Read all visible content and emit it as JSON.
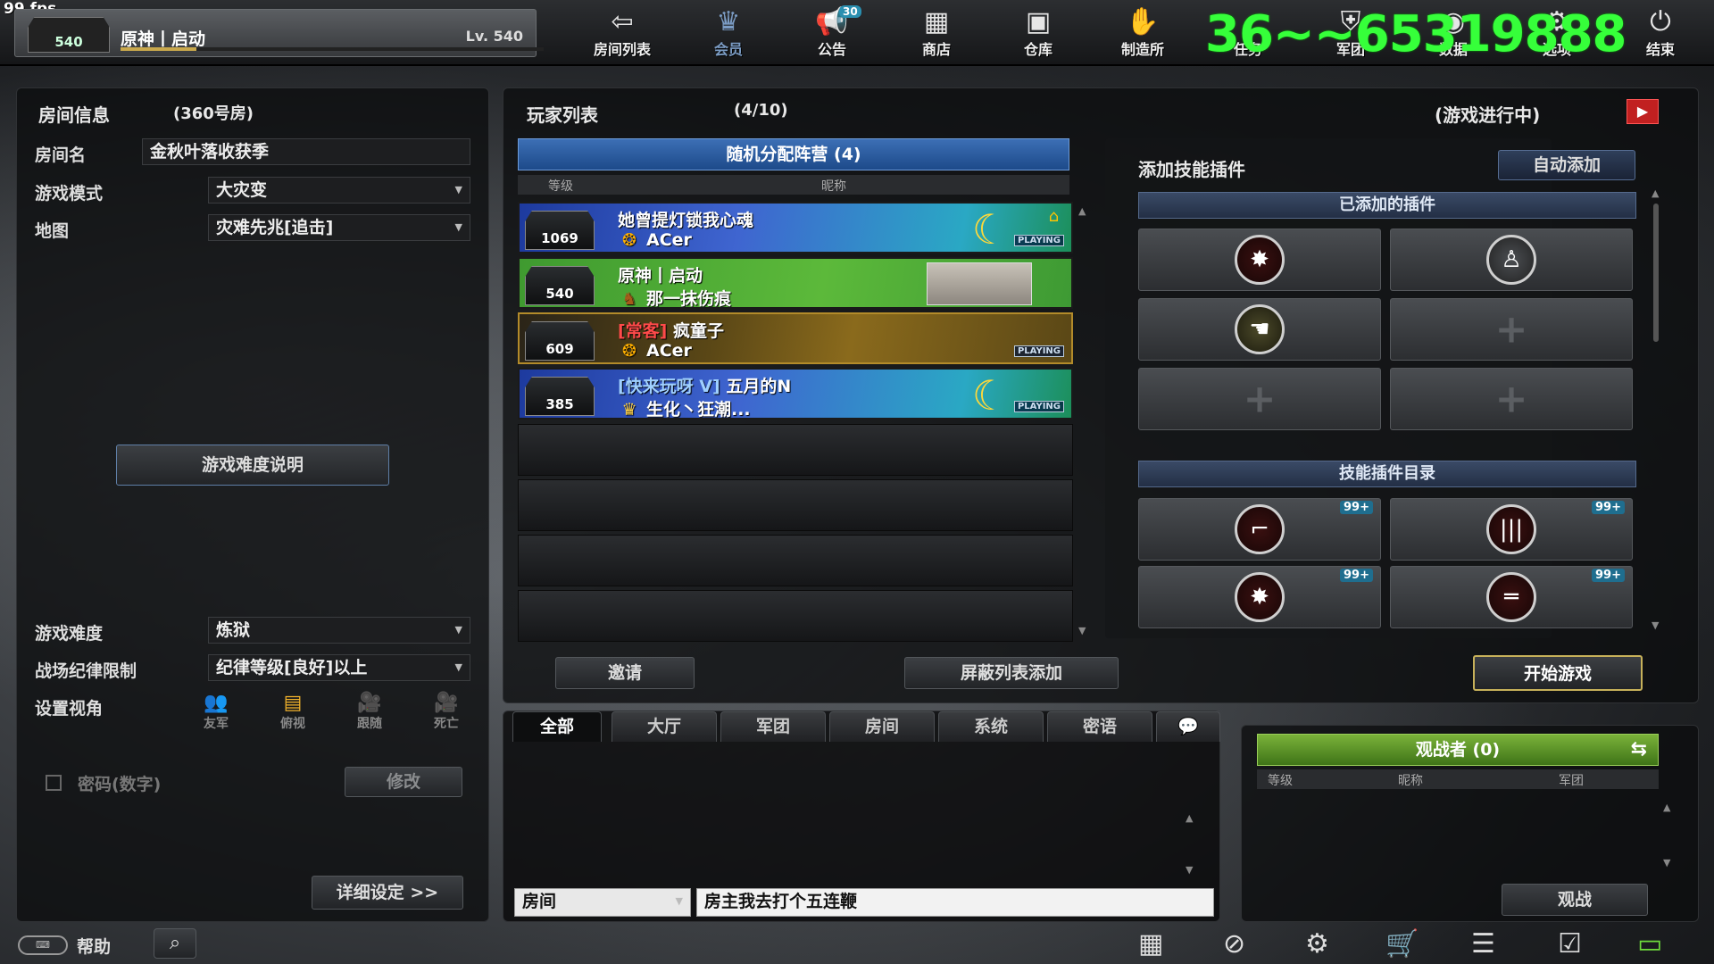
{
  "fps": "99 fps",
  "overlay_text": "36~~65319888",
  "profile": {
    "rank": "540",
    "name": "原神丨启动",
    "level": "Lv. 540",
    "xp_fraction": 0.18
  },
  "nav": [
    {
      "label": "房间列表",
      "icon": "arrow-left-icon"
    },
    {
      "label": "会员",
      "icon": "crown-icon"
    },
    {
      "label": "公告",
      "icon": "megaphone-icon",
      "badge": "30"
    },
    {
      "label": "商店",
      "icon": "shop-icon"
    },
    {
      "label": "仓库",
      "icon": "briefcase-icon"
    },
    {
      "label": "制造所",
      "icon": "handshake-icon"
    },
    {
      "label": "任务",
      "icon": "task-icon"
    },
    {
      "label": "军团",
      "icon": "shield-icon"
    },
    {
      "label": "数据",
      "icon": "data-icon"
    },
    {
      "label": "选项",
      "icon": "gear-icon"
    },
    {
      "label": "结束",
      "icon": "power-icon"
    }
  ],
  "room_info": {
    "title": "房间信息",
    "room_no": "(360号房)",
    "name_label": "房间名",
    "name_value": "金秋叶落收获季",
    "mode_label": "游戏模式",
    "mode_value": "大灾变",
    "map_label": "地图",
    "map_value": "灾难先兆[追击]",
    "difficulty_help": "游戏难度说明",
    "difficulty_label": "游戏难度",
    "difficulty_value": "炼狱",
    "discipline_label": "战场纪律限制",
    "discipline_value": "纪律等级[良好]以上",
    "view_label": "设置视角",
    "views": [
      "友军",
      "俯视",
      "跟随",
      "死亡"
    ],
    "password_label": "密码(数字)",
    "modify": "修改",
    "detail": "详细设定 >>"
  },
  "player_list": {
    "title": "玩家列表",
    "count": "(4/10)",
    "status": "(游戏进行中)",
    "team_header": "随机分配阵营 (4)",
    "col_level": "等级",
    "col_nick": "昵称",
    "players": [
      {
        "rank": "1069",
        "line1": "她曾提灯锁我心魂",
        "line2": "ACer",
        "playing": "PLAYING"
      },
      {
        "rank": "540",
        "line1": "原神丨启动",
        "line2": "那一抹伤痕",
        "playing": ""
      },
      {
        "rank": "609",
        "tag": "[常客]",
        "line1": "疯童子",
        "line2": "ACer",
        "playing": "PLAYING"
      },
      {
        "rank": "385",
        "tag": "[快来玩呀 V]",
        "line1": "五月的N",
        "line2": "生化丶狂潮...",
        "playing": "PLAYING"
      }
    ],
    "invite": "邀请",
    "block_list": "屏蔽列表添加",
    "start": "开始游戏"
  },
  "skills": {
    "title": "添加技能插件",
    "auto_add": "自动添加",
    "added_header": "已添加的插件",
    "catalog_header": "技能插件目录",
    "catalog_count": "99+"
  },
  "chat": {
    "tabs": [
      "全部",
      "大厅",
      "军团",
      "房间",
      "系统",
      "密语"
    ],
    "channel": "房间",
    "input": "房主我去打个五连鞭"
  },
  "spectators": {
    "header": "观战者 (0)",
    "col_level": "等级",
    "col_nick": "昵称",
    "col_clan": "军团",
    "watch": "观战"
  },
  "footer": {
    "help": "帮助"
  },
  "colors": {
    "accent_blue": "#3c6fb5",
    "start_border": "#c7b15a",
    "spectator_green": "#5c8f2c"
  }
}
